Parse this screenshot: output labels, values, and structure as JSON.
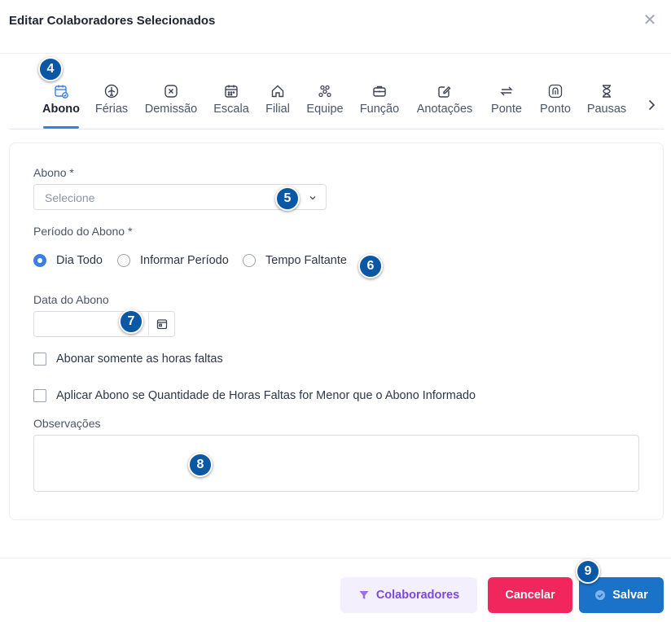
{
  "modal": {
    "title": "Editar Colaboradores Selecionados",
    "close_symbol": "✕"
  },
  "tabs": [
    {
      "label": "Abono",
      "icon": "calendar-badge-icon",
      "active": true
    },
    {
      "label": "Férias",
      "icon": "airplane-icon"
    },
    {
      "label": "Demissão",
      "icon": "x-circle-icon"
    },
    {
      "label": "Escala",
      "icon": "calendar-grid-icon"
    },
    {
      "label": "Filial",
      "icon": "home-icon"
    },
    {
      "label": "Equipe",
      "icon": "people-icon"
    },
    {
      "label": "Função",
      "icon": "briefcase-icon"
    },
    {
      "label": "Anotações",
      "icon": "edit-note-icon"
    },
    {
      "label": "Ponte",
      "icon": "swap-arrows-icon"
    },
    {
      "label": "Ponto",
      "icon": "fingerprint-icon"
    },
    {
      "label": "Pausas",
      "icon": "hourglass-icon"
    }
  ],
  "form": {
    "abono_label": "Abono *",
    "abono_placeholder": "Selecione",
    "periodo_label": "Período do Abono *",
    "radio_options": [
      {
        "label": "Dia Todo",
        "checked": true
      },
      {
        "label": "Informar Período",
        "checked": false
      },
      {
        "label": "Tempo Faltante",
        "checked": false
      }
    ],
    "data_label": "Data do Abono",
    "data_value": "",
    "check_horas_faltas": "Abonar somente as horas faltas",
    "check_aplicar_menor": "Aplicar Abono se Quantidade de Horas Faltas for Menor que o Abono Informado",
    "observacoes_label": "Observações",
    "observacoes_value": ""
  },
  "footer": {
    "colaboradores_label": "Colaboradores",
    "cancelar_label": "Cancelar",
    "salvar_label": "Salvar"
  },
  "badges": [
    "4",
    "5",
    "6",
    "7",
    "8",
    "9"
  ],
  "colors": {
    "accent": "#3b7fe6",
    "badge": "#0a57a6",
    "cancel": "#f0265c",
    "save": "#1a73c9",
    "colab": "#7b48d8"
  }
}
